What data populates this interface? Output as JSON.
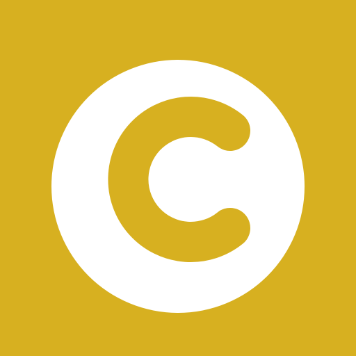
{
  "icon": {
    "name": "copyright-icon",
    "colors": {
      "background": "#D7B020",
      "circle": "#FFFFFF",
      "letter": "#D7B020"
    }
  }
}
